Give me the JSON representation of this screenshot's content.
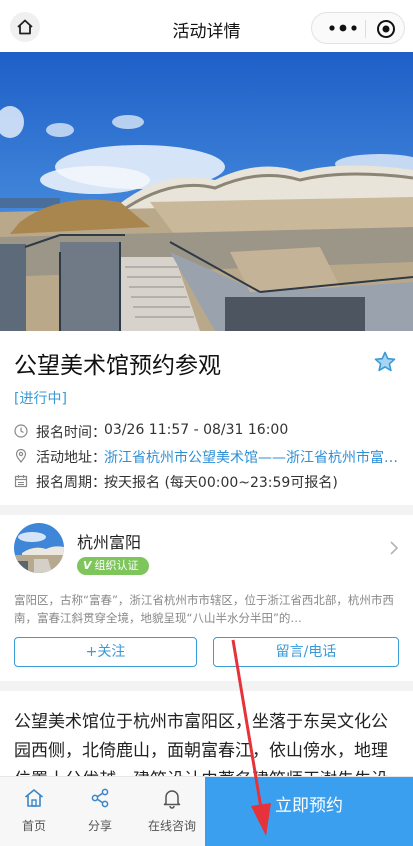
{
  "nav": {
    "title": "活动详情"
  },
  "event": {
    "title": "公望美术馆预约参观",
    "status": "[进行中]",
    "rows": [
      {
        "label": "报名时间：",
        "value": "03/26 11:57 - 08/31 16:00",
        "icon": "clock-icon"
      },
      {
        "label": "活动地址：",
        "value": "浙江省杭州市公望美术馆——浙江省杭州市富阳区",
        "icon": "location-pin-icon"
      },
      {
        "label": "报名周期：",
        "value": "按天报名 (每天00:00~23:59可报名)",
        "icon": "calendar-icon"
      }
    ]
  },
  "organizer": {
    "name": "杭州富阳",
    "badge_mark": "V",
    "badge_text": "组织认证",
    "description": "富阳区，古称“富春”，浙江省杭州市市辖区，位于浙江省西北部，杭州市西南，富春江斜贯穿全境，地貌呈现“八山半水分半田”的…",
    "follow_label": "+关注",
    "contact_label": "留言/电话"
  },
  "description_text": "公望美术馆位于杭州市富阳区，坐落于东吴文化公园西侧，北倚鹿山，面朝富春江，依山傍水，地理位置十分优越，建筑设计由著名建筑师王澍先生设计。",
  "tabbar": {
    "home": "首页",
    "share": "分享",
    "consult": "在线咨询",
    "cta": "立即预约"
  },
  "colors": {
    "accent": "#3a9ad6",
    "cta": "#3b9ff0",
    "badge": "#7ec55c",
    "annotation": "#e6323a"
  }
}
